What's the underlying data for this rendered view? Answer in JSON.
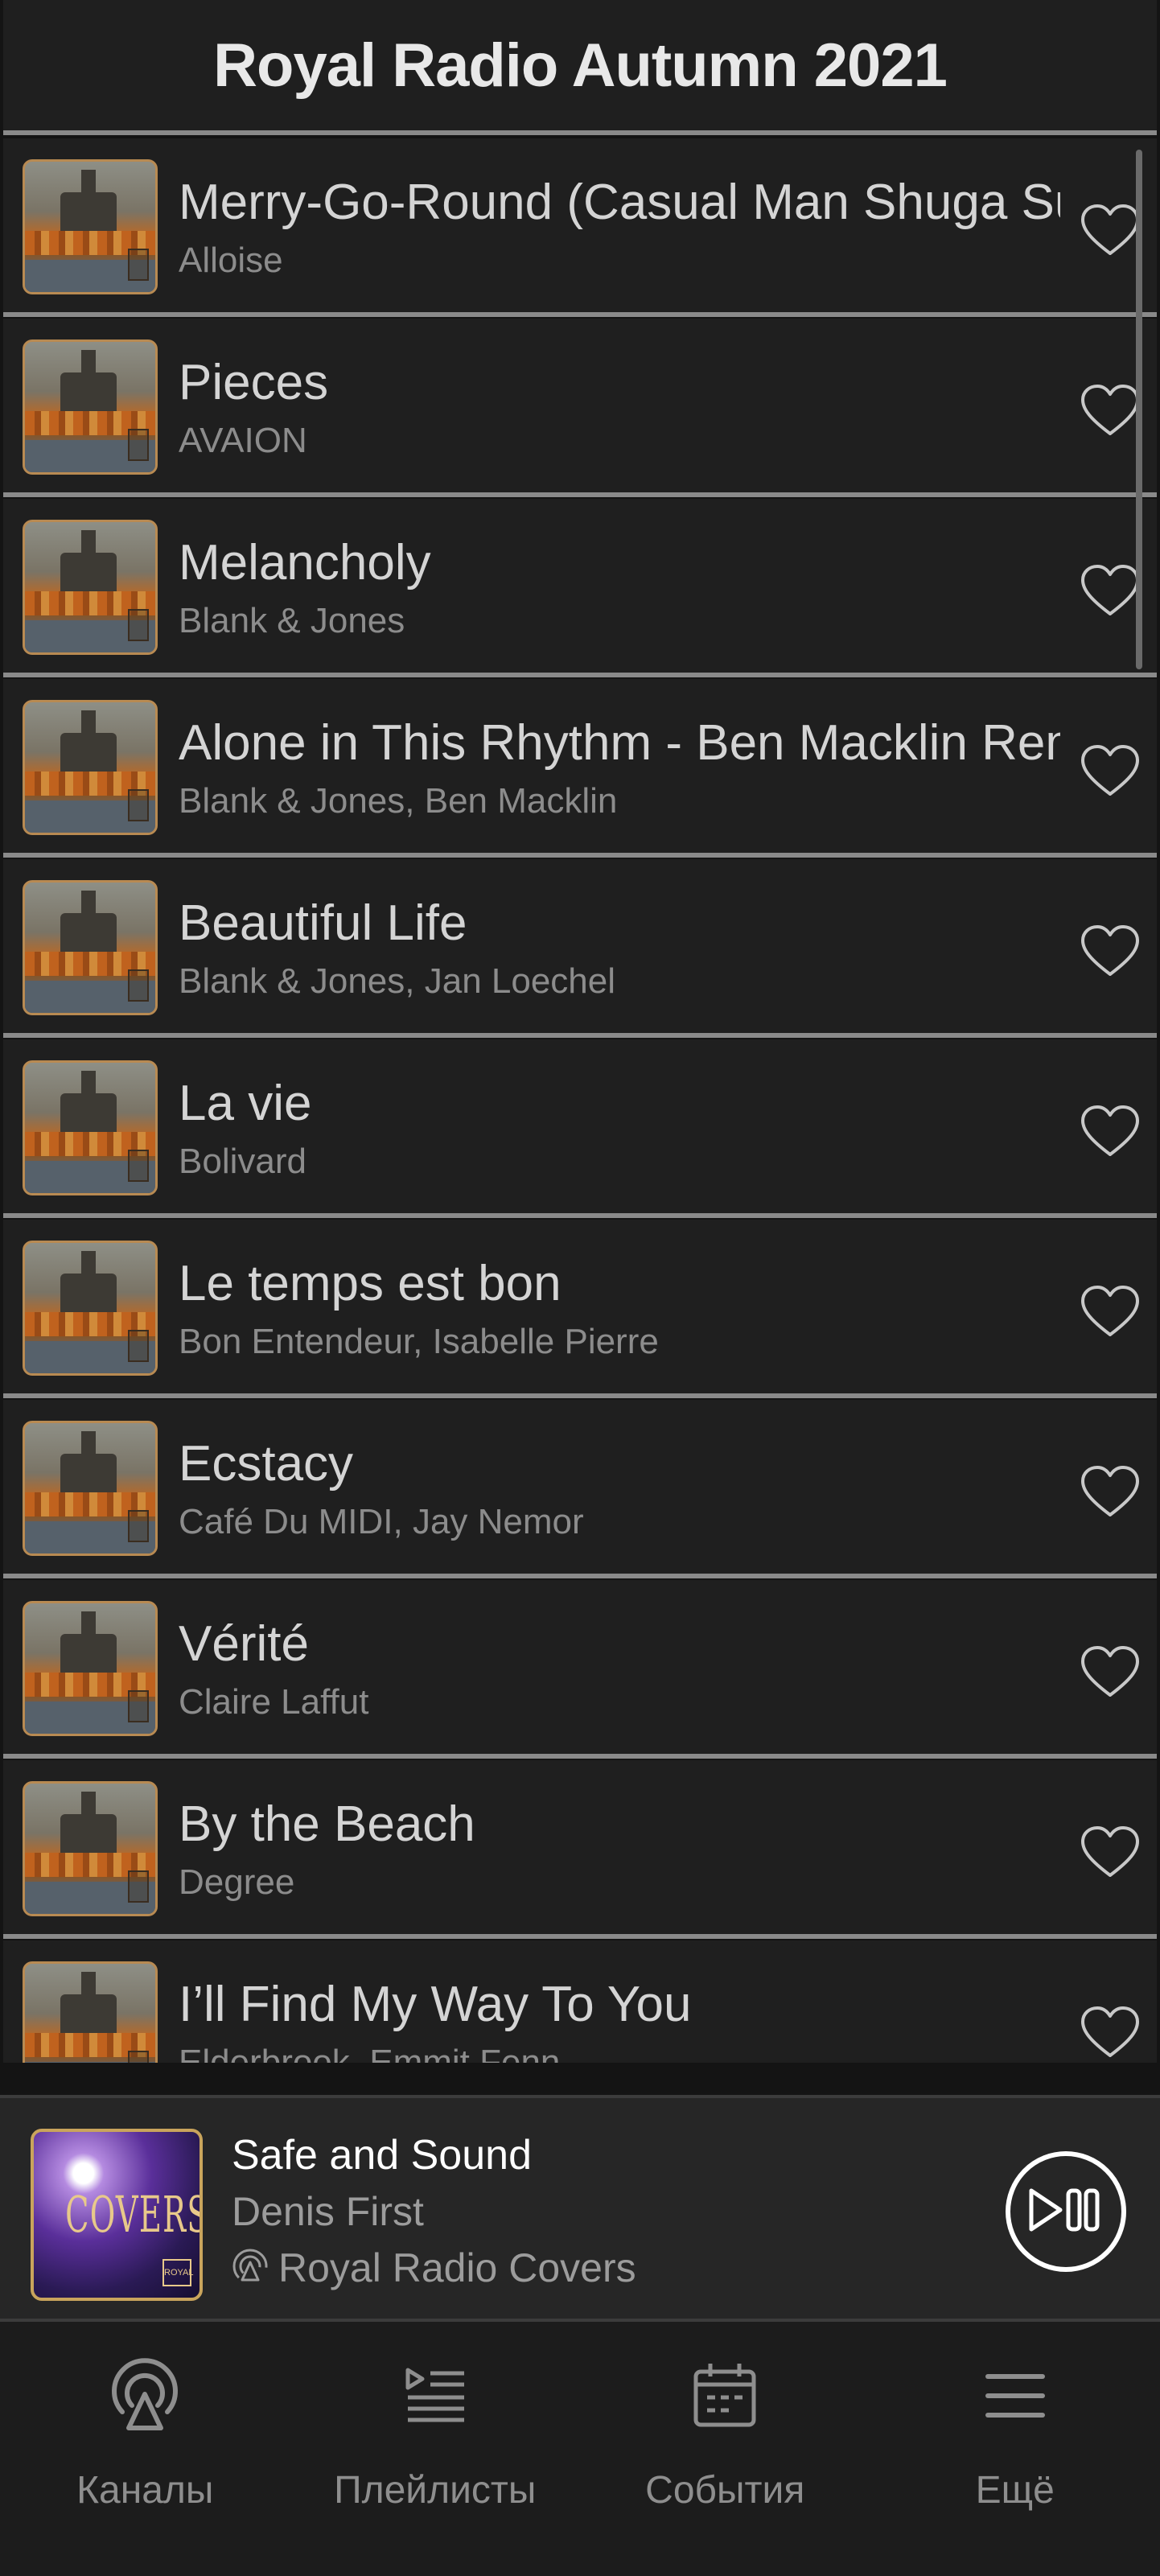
{
  "header": {
    "title": "Royal Radio Autumn 2021"
  },
  "tracks": [
    {
      "title": "Merry-Go-Round (Casual Man Shuga Sun Remix)",
      "artist": "Alloise"
    },
    {
      "title": "Pieces",
      "artist": "AVAION"
    },
    {
      "title": "Melancholy",
      "artist": "Blank & Jones"
    },
    {
      "title": "Alone in This Rhythm - Ben Macklin Remix",
      "artist": "Blank & Jones, Ben Macklin"
    },
    {
      "title": "Beautiful Life",
      "artist": "Blank & Jones, Jan Loechel"
    },
    {
      "title": "La vie",
      "artist": "Bolivard"
    },
    {
      "title": "Le temps est bon",
      "artist": "Bon Entendeur, Isabelle Pierre"
    },
    {
      "title": "Ecstacy",
      "artist": "Café Du MIDI, Jay Nemor"
    },
    {
      "title": "Vérité",
      "artist": "Claire Laffut"
    },
    {
      "title": "By the Beach",
      "artist": "Degree"
    },
    {
      "title": "I’ll Find My Way To You",
      "artist": "Elderbrook, Emmit Fenn"
    }
  ],
  "player": {
    "title": "Safe and Sound",
    "artist": "Denis First",
    "channel": "Royal Radio Covers",
    "cover_text": "COVERS",
    "cover_brand": "ROYAL"
  },
  "nav": [
    {
      "label": "Каналы",
      "icon": "radio-icon"
    },
    {
      "label": "Плейлисты",
      "icon": "playlist-icon"
    },
    {
      "label": "События",
      "icon": "calendar-icon"
    },
    {
      "label": "Ещё",
      "icon": "menu-icon"
    }
  ],
  "colors": {
    "background": "#141414",
    "row": "#1f1f1f",
    "separator": "#8a8a8a",
    "title_text": "#d4d4d4",
    "secondary_text": "#8c8c8c",
    "accent_gold": "#c9a45c"
  }
}
